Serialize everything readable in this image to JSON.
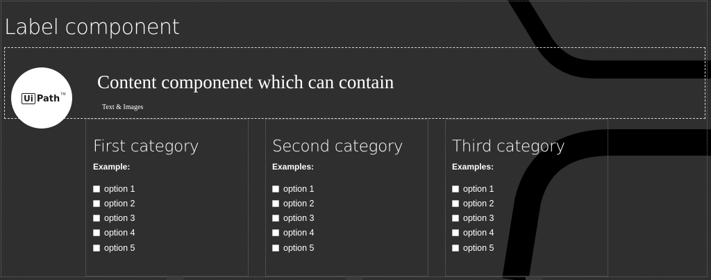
{
  "page": {
    "title": "Label component"
  },
  "header": {
    "logo_text": "UiPath",
    "title": "Content componenet which can contain",
    "subtitle": "Text & Images"
  },
  "categories": [
    {
      "title": "First category",
      "example_label": "Example:",
      "options": [
        "option 1",
        "option 2",
        "option 3",
        "option 4",
        "option 5"
      ]
    },
    {
      "title": "Second category",
      "example_label": "Examples:",
      "options": [
        "option 1",
        "option 2",
        "option 3",
        "option 4",
        "option 5"
      ]
    },
    {
      "title": "Third category",
      "example_label": "Examples:",
      "options": [
        "option 1",
        "option 2",
        "option 3",
        "option 4",
        "option 5"
      ]
    }
  ],
  "colors": {
    "background": "#2f2f2f",
    "stripes": "#000000",
    "text": "#ffffff"
  },
  "icons": {
    "logo": "uipath-logo-icon",
    "checkbox": "checkbox-icon"
  }
}
